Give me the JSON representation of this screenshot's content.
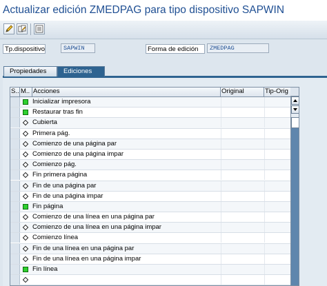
{
  "window": {
    "title": "Actualizar edición ZMEDPAG para tipo dispositivo SAPWIN"
  },
  "toolbar": {
    "buttons": [
      {
        "icon": "pencil-icon",
        "name": "edit-button"
      },
      {
        "icon": "switch-display-change-icon",
        "name": "display-change-button"
      },
      {
        "icon": "list-icon",
        "name": "overview-button"
      }
    ]
  },
  "header_fields": {
    "device_type_label": "Tp.dispositivo",
    "device_type_value": "SAPWIN",
    "print_format_label": "Forma de edición",
    "print_format_value": "ZMEDPAG"
  },
  "tabs": [
    {
      "label": "Propiedades",
      "active": false
    },
    {
      "label": "Ediciones",
      "active": true
    }
  ],
  "table": {
    "columns": [
      "S..",
      "M..",
      "Acciones",
      "Original",
      "Tip-Orig"
    ],
    "rows": [
      {
        "status": "green",
        "action": "Inicializar impresora"
      },
      {
        "status": "green",
        "action": "Restaurar tras fin"
      },
      {
        "status": "diamond",
        "action": "Cubierta"
      },
      {
        "status": "diamond",
        "action": "Primera pág."
      },
      {
        "status": "diamond",
        "action": "Comienzo de una página par"
      },
      {
        "status": "diamond",
        "action": "Comienzo de una página impar"
      },
      {
        "status": "diamond",
        "action": "Comienzo pág."
      },
      {
        "status": "diamond",
        "action": "Fin primera página"
      },
      {
        "status": "diamond",
        "action": "Fin de una página par"
      },
      {
        "status": "diamond",
        "action": "Fin de una página impar"
      },
      {
        "status": "green",
        "action": "Fin página"
      },
      {
        "status": "diamond",
        "action": "Comienzo de una línea en una página par"
      },
      {
        "status": "diamond",
        "action": "Comienzo de una línea en una página impar"
      },
      {
        "status": "diamond",
        "action": "Comienzo línea"
      },
      {
        "status": "diamond",
        "action": "Fin de una línea en una página par"
      },
      {
        "status": "diamond",
        "action": "Fin de una línea en una página impar"
      },
      {
        "status": "green",
        "action": "Fin línea"
      },
      {
        "status": "diamond",
        "action": ""
      }
    ]
  },
  "colors": {
    "title": "#1f4f93",
    "tab_active": "#2e6390",
    "status_green": "#2fcf2f",
    "scroll_track": "#5f86ad"
  }
}
